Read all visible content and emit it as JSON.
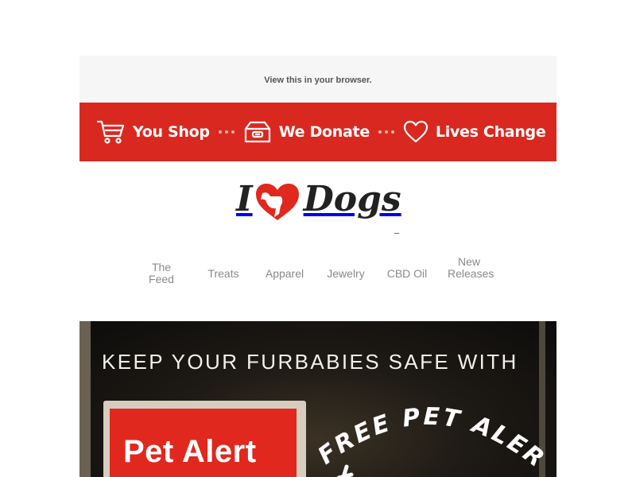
{
  "preheader": {
    "view_in_browser": "View this in your browser."
  },
  "banner": {
    "bg_color": "#d9281f",
    "items": [
      {
        "label": "You Shop",
        "icon": "shopping-cart-icon"
      },
      {
        "label": "We Donate",
        "icon": "donation-box-icon"
      },
      {
        "label": "Lives Change",
        "icon": "heart-outline-icon"
      }
    ]
  },
  "logo": {
    "part1": "I",
    "part2": "Dogs",
    "heart_icon": "heart-dog-silhouette-icon",
    "heart_color": "#e0281f"
  },
  "nav": {
    "items": [
      {
        "label": "The Feed"
      },
      {
        "label": "Treats"
      },
      {
        "label": "Apparel"
      },
      {
        "label": "Jewelry"
      },
      {
        "label": "CBD Oil"
      },
      {
        "label": "New Releases"
      }
    ]
  },
  "hero": {
    "headline": "KEEP YOUR FURBABIES SAFE WITH",
    "sticker_text": "Pet Alert",
    "arc_text": "FREE PET ALERT"
  }
}
